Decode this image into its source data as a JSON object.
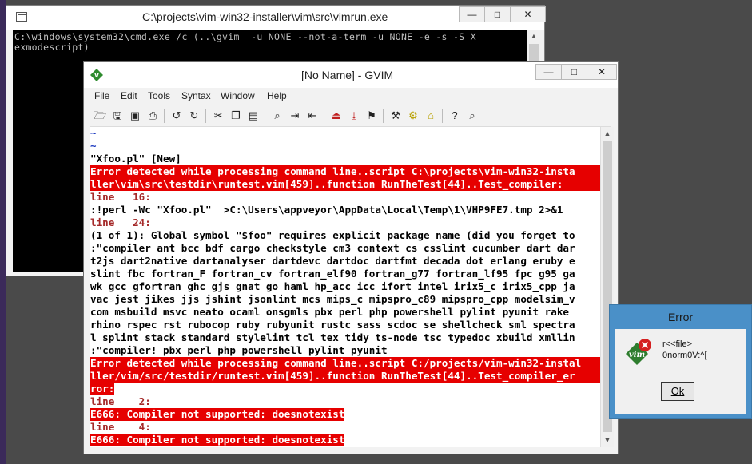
{
  "cmd_window": {
    "title": "C:\\projects\\vim-win32-installer\\vim\\src\\vimrun.exe",
    "lines": [
      "C:\\windows\\system32\\cmd.exe /c (..\\gvim  -u NONE --not-a-term -u NONE -e -s -S X",
      "exmodescript)"
    ],
    "buttons": {
      "minimize": "—",
      "maximize": "□",
      "close": "✕"
    }
  },
  "gvim_window": {
    "title": "[No Name] - GVIM",
    "buttons": {
      "minimize": "—",
      "maximize": "□",
      "close": "✕"
    },
    "menu": [
      "File",
      "Edit",
      "Tools",
      "Syntax",
      "Window",
      "Help"
    ],
    "toolbar_icons": [
      "open-icon",
      "save-icon",
      "save-all-icon",
      "print-icon",
      "undo-icon",
      "redo-icon",
      "cut-icon",
      "copy-icon",
      "paste-icon",
      "replace-icon",
      "find-next-icon",
      "find-prev-icon",
      "load-session-icon",
      "save-session-icon",
      "run-script-icon",
      "make-icon",
      "build-tags-icon",
      "jump-tag-icon",
      "help-icon",
      "find-help-icon"
    ],
    "lines": [
      {
        "type": "tilde",
        "text": "~"
      },
      {
        "type": "tilde",
        "text": "~"
      },
      {
        "type": "normal",
        "text": "\"Xfoo.pl\" [New]"
      },
      {
        "type": "err",
        "text": "Error detected while processing command line..script C:\\projects\\vim-win32-insta"
      },
      {
        "type": "err",
        "text": "ller\\vim\\src\\testdir\\runtest.vim[459]..function RunTheTest[44]..Test_compiler:"
      },
      {
        "type": "lnr",
        "text": "line   16:"
      },
      {
        "type": "normal",
        "text": ":!perl -Wc \"Xfoo.pl\"  >C:\\Users\\appveyor\\AppData\\Local\\Temp\\1\\VHP9FE7.tmp 2>&1"
      },
      {
        "type": "lnr",
        "text": "line   24:"
      },
      {
        "type": "normal",
        "text": "(1 of 1): Global symbol \"$foo\" requires explicit package name (did you forget to"
      },
      {
        "type": "normal",
        "text": ":\"compiler ant bcc bdf cargo checkstyle cm3 context cs csslint cucumber dart dar"
      },
      {
        "type": "normal",
        "text": "t2js dart2native dartanalyser dartdevc dartdoc dartfmt decada dot erlang eruby e"
      },
      {
        "type": "normal",
        "text": "slint fbc fortran_F fortran_cv fortran_elf90 fortran_g77 fortran_lf95 fpc g95 ga"
      },
      {
        "type": "normal",
        "text": "wk gcc gfortran ghc gjs gnat go haml hp_acc icc ifort intel irix5_c irix5_cpp ja"
      },
      {
        "type": "normal",
        "text": "vac jest jikes jjs jshint jsonlint mcs mips_c mipspro_c89 mipspro_cpp modelsim_v"
      },
      {
        "type": "normal",
        "text": "com msbuild msvc neato ocaml onsgmls pbx perl php powershell pylint pyunit rake"
      },
      {
        "type": "normal",
        "text": "rhino rspec rst rubocop ruby rubyunit rustc sass scdoc se shellcheck sml spectra"
      },
      {
        "type": "normal",
        "text": "l splint stack standard stylelint tcl tex tidy ts-node tsc typedoc xbuild xmllin"
      },
      {
        "type": "normal",
        "text": ":\"compiler! pbx perl php powershell pylint pyunit"
      },
      {
        "type": "err",
        "text": "Error detected while processing command line..script C:/projects/vim-win32-instal"
      },
      {
        "type": "err",
        "text": "ller/vim/src/testdir/runtest.vim[459]..function RunTheTest[44]..Test_compiler_er"
      },
      {
        "type": "err",
        "text": "ror:"
      },
      {
        "type": "lnr",
        "text": "line    2:"
      },
      {
        "type": "err",
        "text": "E666: Compiler not supported: doesnotexist"
      },
      {
        "type": "lnr",
        "text": "line    4:"
      },
      {
        "type": "err",
        "text": "E666: Compiler not supported: doesnotexist"
      }
    ]
  },
  "error_dialog": {
    "title": "Error",
    "message": "r<<file>\n0norm0V:^[",
    "ok_label": "Ok",
    "colors": {
      "frame": "#4a90c8",
      "icon_red": "#d42020"
    }
  },
  "colors": {
    "error_bg": "#e60000",
    "line_nr": "#a52a2a",
    "tilde": "#1f3cc0"
  }
}
